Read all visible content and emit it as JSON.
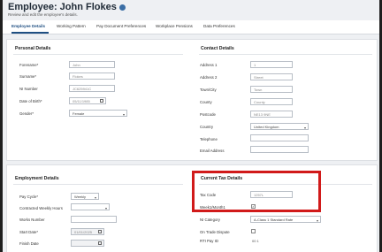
{
  "page": {
    "title": "Employee: John Flokes",
    "subtitle": "Review and edit the employee's details."
  },
  "tabs": [
    {
      "label": "Employee Details"
    },
    {
      "label": "Working Pattern"
    },
    {
      "label": "Pay Document Preferences"
    },
    {
      "label": "Workplace Pensions"
    },
    {
      "label": "Data Preferences"
    }
  ],
  "personal": {
    "title": "Personal Details",
    "forename_label": "Forename*",
    "forename_value": "John",
    "surname_label": "Surname*",
    "surname_value": "Flokes",
    "ni_label": "NI Number",
    "ni_value": "JC625941C",
    "dob_label": "Date of Birth*",
    "dob_value": "05/11/1985",
    "gender_label": "Gender*",
    "gender_value": "Female"
  },
  "contact": {
    "title": "Contact Details",
    "address1_label": "Address 1",
    "address1_value": "1",
    "address2_label": "Address 2",
    "address2_value": "Street",
    "town_label": "Town/City",
    "town_value": "Town",
    "county_label": "County",
    "county_value": "County",
    "postcode_label": "Postcode",
    "postcode_value": "NE13 9NE",
    "country_label": "Country",
    "country_value": "United Kingdom",
    "telephone_label": "Telephone",
    "email_label": "Email Address"
  },
  "employment": {
    "title": "Employment Details",
    "paycycle_label": "Pay Cycle*",
    "paycycle_value": "Weekly",
    "contracted_label": "Contracted Weekly Hours",
    "works_label": "Works Number",
    "start_label": "Start Date*",
    "start_value": "01/01/2025",
    "finish_label": "Finish Date"
  },
  "tax": {
    "title": "Current Tax Details",
    "taxcode_label": "Tax Code",
    "taxcode_value": "1257L",
    "week1_label": "Week1/Month1",
    "week1_checked": "✓",
    "nicategory_label": "NI Category",
    "nicategory_value": "A-Class 1 Standard Rate",
    "ontrade_label": "On Trade Dispute",
    "rti_label": "RTI Pay ID",
    "rti_value": "00 1"
  },
  "colors": {
    "highlight": "#d11a1a",
    "accent": "#1f4f82"
  }
}
